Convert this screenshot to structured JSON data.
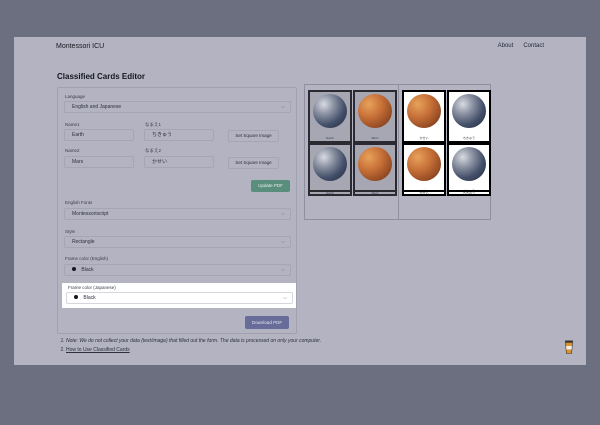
{
  "nav": {
    "brand": "Montessori ICU",
    "links": [
      "About",
      "Contact"
    ]
  },
  "editor": {
    "title": "Classified Cards Editor",
    "language": {
      "label": "Language",
      "value": "English and Japanese"
    },
    "card1": {
      "name_label": "Name1",
      "name_value": "Earth",
      "kana_label": "なまえ1",
      "kana_value": "ちきゅう",
      "button": "Set Square Image"
    },
    "card2": {
      "name_label": "Name2",
      "name_value": "Mars",
      "kana_label": "なまえ2",
      "kana_value": "かせい",
      "button": "Set Square Image"
    },
    "update_button": "Update PDF",
    "english_fonts": {
      "label": "English Fonts",
      "value": "Montessoriscript"
    },
    "style": {
      "label": "Style",
      "value": "Rectangle"
    },
    "frame_en": {
      "label": "Frame color (English)",
      "value": "Black"
    },
    "frame_ja": {
      "label": "Frame color (Japanese)",
      "value": "Black"
    },
    "download_button": "Download PDF"
  },
  "notes": {
    "note1": "Note: We do not collect your data (text/image) that filled out the form. The data is processed on only your computer.",
    "note2": "How to Use Classified Cards"
  },
  "preview": {
    "left": [
      {
        "image": "earth",
        "caption": "Earth"
      },
      {
        "image": "mars",
        "caption": "Mars"
      },
      {
        "image": "earth",
        "caption": "Earth"
      },
      {
        "image": "mars",
        "caption": "Mars"
      }
    ],
    "left_strips": [
      "Earth",
      "Mars"
    ],
    "right": [
      {
        "image": "mars",
        "caption": "かせい"
      },
      {
        "image": "earth",
        "caption": "ちきゅう"
      },
      {
        "image": "mars",
        "caption": "かせい"
      },
      {
        "image": "earth",
        "caption": "ちきゅう"
      }
    ],
    "right_strips": [
      "かせい",
      "ちきゅう"
    ]
  },
  "icons": {
    "chevron": "chevron-down-icon",
    "cup": "coffee-cup-icon"
  },
  "colors": {
    "update": "#5a8e7c",
    "download": "#676d98",
    "highlight": "#ffffff"
  }
}
